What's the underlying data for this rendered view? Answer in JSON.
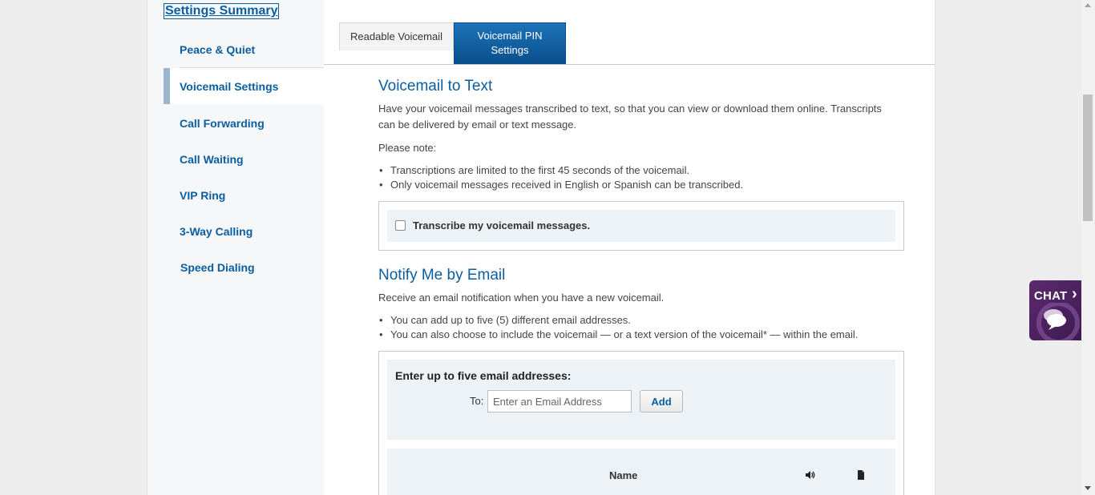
{
  "sidebar": {
    "summary_link": "Settings Summary",
    "items": [
      {
        "label": "Peace & Quiet"
      },
      {
        "label": "Voicemail Settings"
      },
      {
        "label": "Call Forwarding"
      },
      {
        "label": "Call Waiting"
      },
      {
        "label": "VIP Ring"
      },
      {
        "label": "3-Way Calling"
      },
      {
        "label": "Speed Dialing"
      }
    ]
  },
  "tabs": [
    {
      "label": "Readable Voicemail"
    },
    {
      "label": "Voicemail PIN Settings"
    }
  ],
  "voicemail_to_text": {
    "heading": "Voicemail to Text",
    "description": "Have your voicemail messages transcribed to text, so that you can view or download them online. Transcripts can be delivered by email or text message.",
    "note_label": "Please note:",
    "bullets": [
      "Transcriptions are limited to the first 45 seconds of the voicemail.",
      "Only voicemail messages received in English or Spanish can be transcribed."
    ],
    "checkbox_label": "Transcribe my voicemail messages."
  },
  "notify_email": {
    "heading": "Notify Me by Email",
    "description": "Receive an email notification when you have a new voicemail.",
    "bullets": [
      "You can add up to five (5) different email addresses.",
      "You can also choose to include the voicemail — or a text version of the voicemail* — within the email."
    ],
    "form_title": "Enter up to five email addresses:",
    "to_label": "To:",
    "email_placeholder": "Enter an Email Address",
    "add_label": "Add",
    "table_header_name": "Name"
  },
  "chat": {
    "label": "CHAT",
    "arrow": "›"
  },
  "icons": {
    "audio": "speaker-icon",
    "file": "document-icon",
    "chat_bubbles": "chat-bubbles-icon"
  },
  "colors": {
    "accent": "#0a5ea0",
    "tab_active": "#0a4f8d",
    "chat": "#4a2060"
  }
}
